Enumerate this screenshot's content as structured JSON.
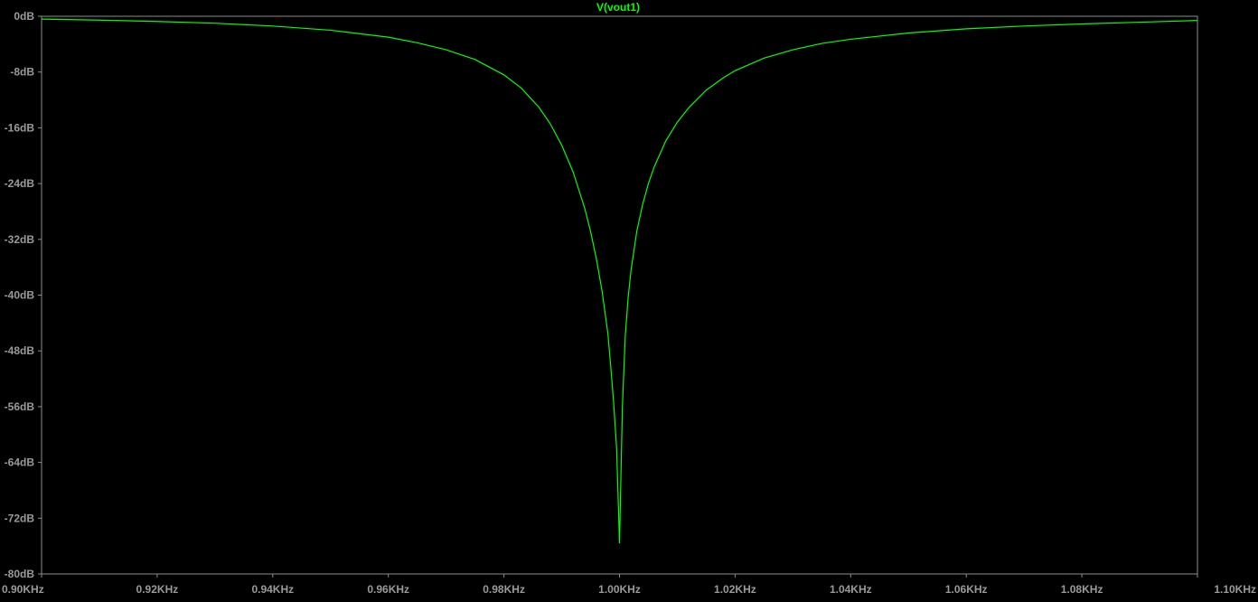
{
  "chart_data": {
    "type": "line",
    "title": "",
    "xlabel": "",
    "ylabel": "",
    "x_unit": "KHz",
    "y_unit": "dB",
    "xlim": [
      0.9,
      1.1
    ],
    "ylim": [
      -80,
      0
    ],
    "x_ticks": [
      {
        "value": 0.9,
        "label": "0.90KHz"
      },
      {
        "value": 0.92,
        "label": "0.92KHz"
      },
      {
        "value": 0.94,
        "label": "0.94KHz"
      },
      {
        "value": 0.96,
        "label": "0.96KHz"
      },
      {
        "value": 0.98,
        "label": "0.98KHz"
      },
      {
        "value": 1.0,
        "label": "1.00KHz"
      },
      {
        "value": 1.02,
        "label": "1.02KHz"
      },
      {
        "value": 1.04,
        "label": "1.04KHz"
      },
      {
        "value": 1.06,
        "label": "1.06KHz"
      },
      {
        "value": 1.08,
        "label": "1.08KHz"
      },
      {
        "value": 1.1,
        "label": "1.10KHz"
      }
    ],
    "y_ticks": [
      {
        "value": 0,
        "label": "0dB"
      },
      {
        "value": -8,
        "label": "-8dB"
      },
      {
        "value": -16,
        "label": "-16dB"
      },
      {
        "value": -24,
        "label": "-24dB"
      },
      {
        "value": -32,
        "label": "-32dB"
      },
      {
        "value": -40,
        "label": "-40dB"
      },
      {
        "value": -48,
        "label": "-48dB"
      },
      {
        "value": -56,
        "label": "-56dB"
      },
      {
        "value": -64,
        "label": "-64dB"
      },
      {
        "value": -72,
        "label": "-72dB"
      },
      {
        "value": -80,
        "label": "-80dB"
      }
    ],
    "grid": false,
    "legend": "top-center",
    "series": [
      {
        "name": "V(vout1)",
        "color": "#00ff00",
        "x": [
          0.9,
          0.91,
          0.92,
          0.93,
          0.94,
          0.95,
          0.96,
          0.965,
          0.97,
          0.975,
          0.98,
          0.983,
          0.986,
          0.988,
          0.99,
          0.992,
          0.994,
          0.995,
          0.996,
          0.997,
          0.998,
          0.9985,
          0.999,
          0.9995,
          1.0,
          1.0005,
          1.001,
          1.0015,
          1.002,
          1.003,
          1.004,
          1.005,
          1.006,
          1.008,
          1.01,
          1.012,
          1.015,
          1.018,
          1.02,
          1.025,
          1.03,
          1.035,
          1.04,
          1.05,
          1.06,
          1.07,
          1.08,
          1.09,
          1.1
        ],
        "y": [
          -0.4,
          -0.55,
          -0.75,
          -1.0,
          -1.4,
          -2.0,
          -3.0,
          -3.8,
          -4.8,
          -6.2,
          -8.4,
          -10.3,
          -13.0,
          -15.4,
          -18.5,
          -22.4,
          -27.6,
          -30.9,
          -34.8,
          -39.5,
          -45.6,
          -50.4,
          -55.6,
          -62.0,
          -75.6,
          -56.0,
          -45.8,
          -40.3,
          -36.4,
          -30.8,
          -27.0,
          -24.0,
          -21.6,
          -17.9,
          -15.2,
          -13.1,
          -10.6,
          -8.8,
          -7.8,
          -6.0,
          -4.8,
          -3.9,
          -3.3,
          -2.4,
          -1.8,
          -1.4,
          -1.1,
          -0.85,
          -0.6
        ]
      }
    ]
  }
}
